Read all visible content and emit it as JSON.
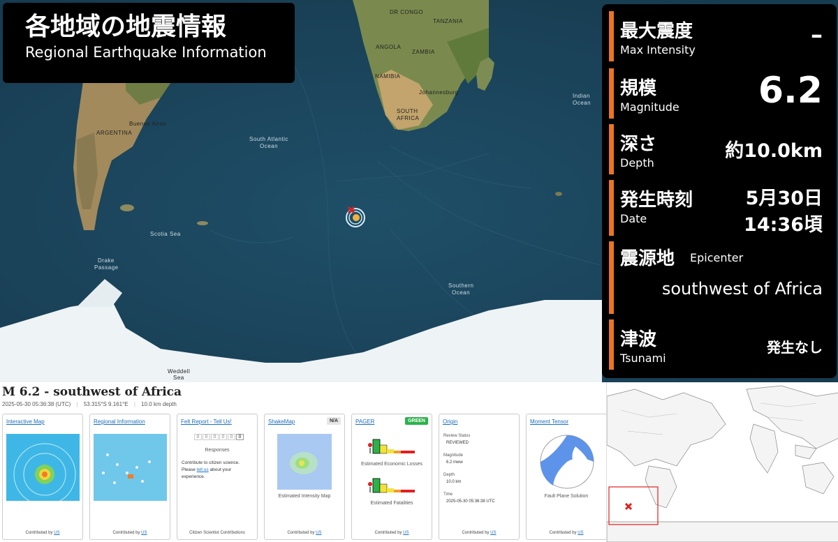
{
  "title": {
    "jp": "各地域の地震情報",
    "en": "Regional Earthquake Information"
  },
  "info": {
    "max_intensity": {
      "jp": "最大震度",
      "en": "Max Intensity",
      "value": "–"
    },
    "magnitude": {
      "jp": "規模",
      "en": "Magnitude",
      "value": "6.2"
    },
    "depth": {
      "jp": "深さ",
      "en": "Depth",
      "value": "約10.0km"
    },
    "date": {
      "jp": "発生時刻",
      "en": "Date",
      "value_line1": "5月30日",
      "value_line2": "14:36頃"
    },
    "epicenter": {
      "jp": "震源地",
      "en": "Epicenter",
      "value": "southwest of Africa"
    },
    "tsunami": {
      "jp": "津波",
      "en": "Tsunami",
      "value": "発生なし"
    }
  },
  "map_labels": {
    "dr_congo": "DR CONGO",
    "tanzania": "TANZANIA",
    "angola": "ANGOLA",
    "zambia": "ZAMBIA",
    "namibia": "NAMIBIA",
    "johannesburg": "Johannesburg",
    "south_africa_1": "SOUTH",
    "south_africa_2": "AFRICA",
    "indian_ocean_1": "Indian",
    "indian_ocean_2": "Ocean",
    "south_atlantic_1": "South Atlantic",
    "south_atlantic_2": "Ocean",
    "argentina": "ARGENTINA",
    "buenos_aires": "Buenos Aires",
    "scotia_sea": "Scotia Sea",
    "drake_1": "Drake",
    "drake_2": "Passage",
    "southern_ocean_1": "Southern",
    "southern_ocean_2": "Ocean",
    "weddell_1": "Weddell",
    "weddell_2": "Sea"
  },
  "usgs": {
    "event_title": "M 6.2 - southwest of Africa",
    "time": "2025-05-30 05:36:38 (UTC)",
    "location": "53.315°S 9.161°E",
    "depth": "10.0 km depth",
    "cards": {
      "interactive_map": {
        "title": "Interactive Map",
        "footer": "Contributed by",
        "footer_link": "US"
      },
      "regional_info": {
        "title": "Regional Information",
        "footer": "Contributed by",
        "footer_link": "US"
      },
      "felt_report": {
        "title": "Felt Report - Tell Us!",
        "digits": [
          "0",
          "0",
          "0",
          "0",
          "0",
          "0"
        ],
        "responses": "Responses",
        "text1": "Contribute to citizen science.",
        "text2a": "Please ",
        "text2_link": "tell us",
        "text2b": " about your",
        "text3": "experience.",
        "footer": "Citizen Scientist Contributions"
      },
      "shakemap": {
        "title": "ShakeMap",
        "badge": "N/A",
        "caption": "Estimated Intensity Map",
        "footer": "Contributed by",
        "footer_link": "US"
      },
      "pager": {
        "title": "PAGER",
        "badge": "GREEN",
        "cap1": "Estimated Economic Losses",
        "cap2": "Estimated Fatalities",
        "footer": "Contributed by",
        "footer_link": "US"
      },
      "origin": {
        "title": "Origin",
        "review_label": "Review Status",
        "review_value": "REVIEWED",
        "mag_label": "Magnitude",
        "mag_value": "6.2 mww",
        "depth_label": "Depth",
        "depth_value": "10.0 km",
        "time_label": "Time",
        "time_value": "2025-05-30 05:36:38 UTC",
        "footer": "Contributed by",
        "footer_link": "US"
      },
      "moment_tensor": {
        "title": "Moment Tensor",
        "caption": "Fault Plane Solution",
        "footer": "Contributed by",
        "footer_link": "US"
      }
    }
  },
  "colors": {
    "accent": "#e87722",
    "panel_bg": "#000000",
    "ocean": "#1d4a63",
    "link": "#1a6fc0",
    "pager_green": "#2bb34a",
    "epicenter_marker": "#e02020"
  }
}
